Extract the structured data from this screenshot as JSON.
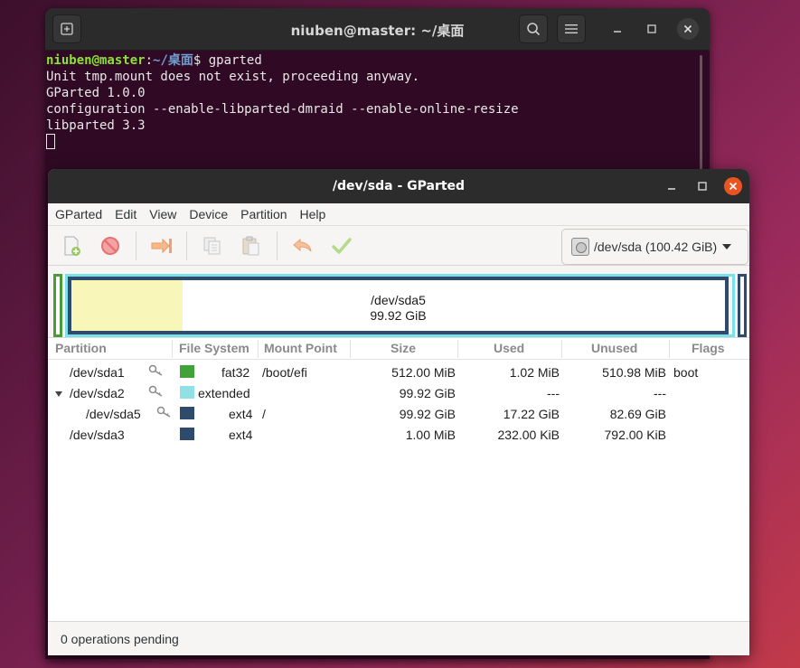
{
  "terminal": {
    "title": "niuben@master: ~/桌面",
    "prompt_user": "niuben@master",
    "prompt_sep": ":",
    "prompt_path": "~/桌面",
    "prompt_symbol": "$",
    "command": " gparted",
    "output": [
      "Unit tmp.mount does not exist, proceeding anyway.",
      "GParted 1.0.0",
      "configuration --enable-libparted-dmraid --enable-online-resize",
      "libparted 3.3"
    ]
  },
  "gparted": {
    "title": "/dev/sda - GParted",
    "menu": [
      "GParted",
      "Edit",
      "View",
      "Device",
      "Partition",
      "Help"
    ],
    "device_selector": "/dev/sda (100.42 GiB)",
    "visual": {
      "label": "/dev/sda5",
      "size": "99.92 GiB",
      "used_fraction": 0.17
    },
    "columns": [
      "Partition",
      "File System",
      "Mount Point",
      "Size",
      "Used",
      "Unused",
      "Flags"
    ],
    "rows": [
      {
        "partition": "/dev/sda1",
        "fs": "fat32",
        "mount": "/boot/efi",
        "size": "512.00 MiB",
        "used": "1.02 MiB",
        "unused": "510.98 MiB",
        "flags": "boot",
        "color": "#3fa33a"
      },
      {
        "partition": "/dev/sda2",
        "fs": "extended",
        "mount": "",
        "size": "99.92 GiB",
        "used": "---",
        "unused": "---",
        "flags": "",
        "color": "#8fe1e6"
      },
      {
        "partition": "/dev/sda5",
        "fs": "ext4",
        "mount": "/",
        "size": "99.92 GiB",
        "used": "17.22 GiB",
        "unused": "82.69 GiB",
        "flags": "",
        "color": "#2f4b6b"
      },
      {
        "partition": "/dev/sda3",
        "fs": "ext4",
        "mount": "",
        "size": "1.00 MiB",
        "used": "232.00 KiB",
        "unused": "792.00 KiB",
        "flags": "",
        "color": "#2f4b6b"
      }
    ],
    "status": "0 operations pending"
  }
}
